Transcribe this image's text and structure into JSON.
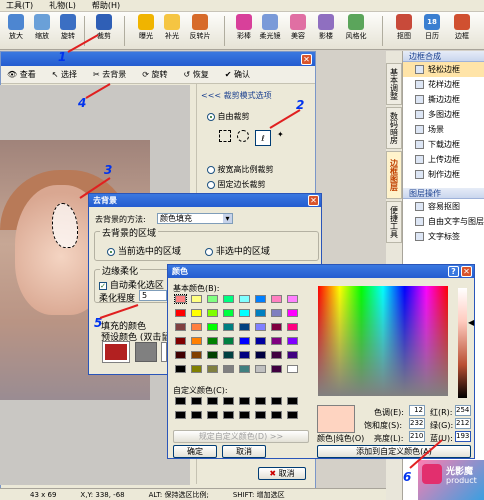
{
  "menubar": [
    "工具(T)",
    "礼物(L)",
    "帮助(H)"
  ],
  "toolbar": [
    {
      "label": "放大",
      "icon": "zoom-in-icon",
      "color": "#4d86d1"
    },
    {
      "label": "缩放",
      "icon": "resize-icon",
      "color": "#6aa0d8"
    },
    {
      "label": "旋转",
      "icon": "rotate-icon",
      "color": "#3b6fc3"
    },
    {
      "label": "裁剪",
      "icon": "crop-icon",
      "color": "#2f5fb6"
    },
    {
      "label": "曝光",
      "icon": "exposure-icon",
      "color": "#f0b400"
    },
    {
      "label": "补光",
      "icon": "fill-light-icon",
      "color": "#f5c542"
    },
    {
      "label": "反转片",
      "icon": "film-icon",
      "color": "#d76b2a"
    },
    {
      "label": "彩棒",
      "icon": "color-bar-icon",
      "color": "#d8409a"
    },
    {
      "label": "柔光镜",
      "icon": "soft-lens-icon",
      "color": "#7a9ad8"
    },
    {
      "label": "美容",
      "icon": "beauty-icon",
      "color": "#e06fa3"
    },
    {
      "label": "影楼",
      "icon": "studio-icon",
      "color": "#8f6fc0"
    },
    {
      "label": "风格化",
      "icon": "stylize-icon",
      "color": "#5ba55b"
    },
    {
      "label": "抠图",
      "icon": "cutout-icon",
      "color": "#c84a3a"
    },
    {
      "label": "日历",
      "icon": "calendar-icon",
      "color": "#3b7fd0",
      "badge": "18"
    },
    {
      "label": "边框",
      "icon": "frame-icon",
      "color": "#d05030"
    }
  ],
  "crop_window": {
    "toolbar": [
      "查看",
      "选择",
      "去背景",
      "旋转",
      "恢复",
      "确认"
    ],
    "panel_title": "<<< 裁剪模式选项",
    "modes": [
      "自由裁剪",
      "按宽高比例裁剪",
      "固定边长裁剪"
    ],
    "tools_label": "tool-icons"
  },
  "status": {
    "size": "43 x 69",
    "coords": "X,Y: 338, -68",
    "alt": "ALT: 保持选区比例;",
    "shift": "SHIFT: 增加选区"
  },
  "side_tabs": [
    "基本调整",
    "数码暗房",
    "边框图层",
    "便捷工具"
  ],
  "right_panel": {
    "section1": "边框合成",
    "items1": [
      "轻松边框",
      "花样边框",
      "撕边边框",
      "多图边框",
      "场景",
      "下载边框",
      "上传边框",
      "制作边框"
    ],
    "section2": "图层操作",
    "items2": [
      "容易抠图",
      "自由文字与图层",
      "文字标签"
    ]
  },
  "bg_dialog": {
    "title": "去背景",
    "method_label": "去背景的方法:",
    "method_value": "颜色填充",
    "area_group": "去背景的区域",
    "area_options": [
      "当前选中的区域",
      "非选中的区域"
    ],
    "edge_group": "边缘柔化",
    "auto_soft": "自动柔化选区",
    "soft_label": "柔化程度",
    "soft_value": "5",
    "fill_label": "填充的颜色",
    "preset_label": "预设颜色 (双击鼠标",
    "cancel": "取消"
  },
  "color_dialog": {
    "title": "颜色",
    "basic_label": "基本颜色(B):",
    "custom_label": "自定义颜色(C):",
    "define_btn": "规定自定义颜色(D) >>",
    "ok": "确定",
    "cancel": "取消",
    "add_btn": "添加到自定义颜色(A)",
    "color_solid": "颜色|纯色(O)",
    "hue_label": "色调(E):",
    "hue": "12",
    "sat_label": "饱和度(S):",
    "sat": "232",
    "lum_label": "亮度(L):",
    "lum": "210",
    "red_label": "红(R):",
    "red": "254",
    "green_label": "绿(G):",
    "green": "212",
    "blue_label": "蓝(U):",
    "blue": "193",
    "selected": "#fed4c1"
  },
  "basic_colors": [
    "#ff8080",
    "#ffff80",
    "#80ff80",
    "#00ff80",
    "#80ffff",
    "#0080ff",
    "#ff80c0",
    "#ff80ff",
    "#ff0000",
    "#ffff00",
    "#80ff00",
    "#00ff40",
    "#00ffff",
    "#0080c0",
    "#8080c0",
    "#ff00ff",
    "#804040",
    "#ff8040",
    "#00ff00",
    "#008080",
    "#004080",
    "#8080ff",
    "#800040",
    "#ff0080",
    "#800000",
    "#ff8000",
    "#008000",
    "#008040",
    "#0000ff",
    "#0000a0",
    "#800080",
    "#8000ff",
    "#400000",
    "#804000",
    "#004000",
    "#004040",
    "#000080",
    "#000040",
    "#400040",
    "#400080",
    "#000000",
    "#808000",
    "#808040",
    "#808080",
    "#408080",
    "#c0c0c0",
    "#400040",
    "#ffffff"
  ],
  "annotations": [
    "1",
    "2",
    "3",
    "4",
    "5",
    "6"
  ],
  "ad": {
    "brand": "光影魔",
    "sub": "product"
  }
}
